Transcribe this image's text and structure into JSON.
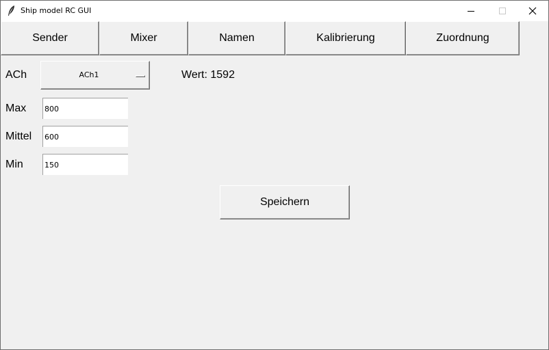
{
  "window": {
    "title": "Ship model RC GUI",
    "controls": [
      "minimize-icon",
      "maximize-icon",
      "close-icon"
    ]
  },
  "tabs": [
    {
      "label": "Sender"
    },
    {
      "label": "Mixer"
    },
    {
      "label": "Namen"
    },
    {
      "label": "Kalibrierung"
    },
    {
      "label": "Zuordnung"
    }
  ],
  "channel": {
    "label": "ACh",
    "selected": "ACh1",
    "value_text": "Wert: 1592"
  },
  "fields": {
    "max": {
      "label": "Max",
      "value": "800"
    },
    "mittel": {
      "label": "Mittel",
      "value": "600"
    },
    "min": {
      "label": "Min",
      "value": "150"
    }
  },
  "save_label": "Speichern",
  "colors": {
    "background": "#f0f0f0",
    "titlebar": "#ffffff",
    "entry_background": "#ffffff"
  }
}
